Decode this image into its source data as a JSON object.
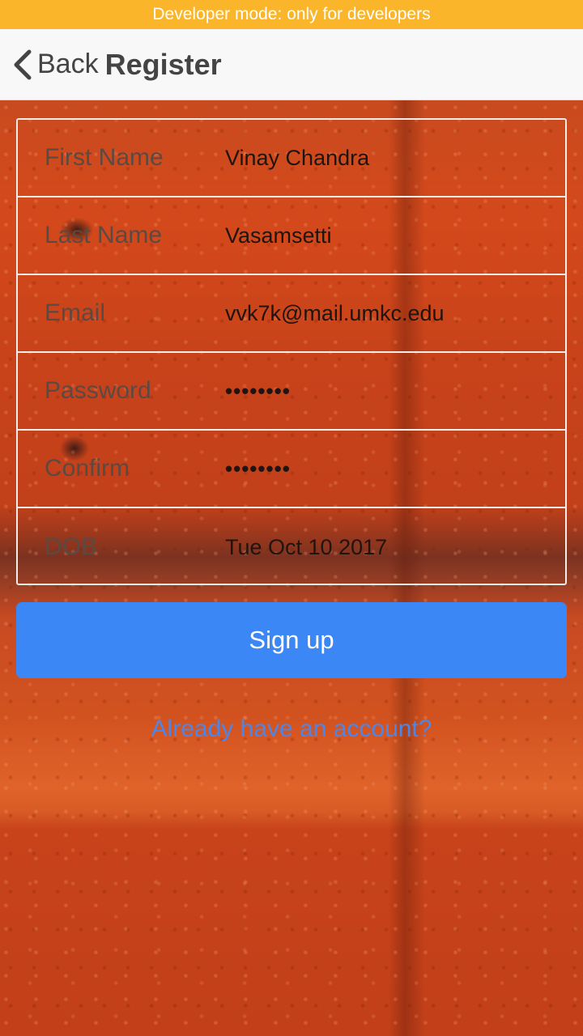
{
  "dev_banner": "Developer mode: only for developers",
  "navbar": {
    "back_label": "Back",
    "title": "Register",
    "back_icon": "chevron-left-icon"
  },
  "form": {
    "rows": [
      {
        "label": "First Name",
        "value": "Vinay Chandra"
      },
      {
        "label": "Last Name",
        "value": "Vasamsetti"
      },
      {
        "label": "Email",
        "value": "vvk7k@mail.umkc.edu"
      },
      {
        "label": "Password",
        "value": "••••••••"
      },
      {
        "label": "Confirm",
        "value": "••••••••"
      },
      {
        "label": "DOB",
        "value": "Tue Oct 10 2017"
      }
    ]
  },
  "signup_label": "Sign up",
  "login_link": "Already have an account?",
  "colors": {
    "banner": "#fbb52a",
    "button": "#3b87f6",
    "link": "#4b86e8",
    "background": "#c8431a"
  }
}
